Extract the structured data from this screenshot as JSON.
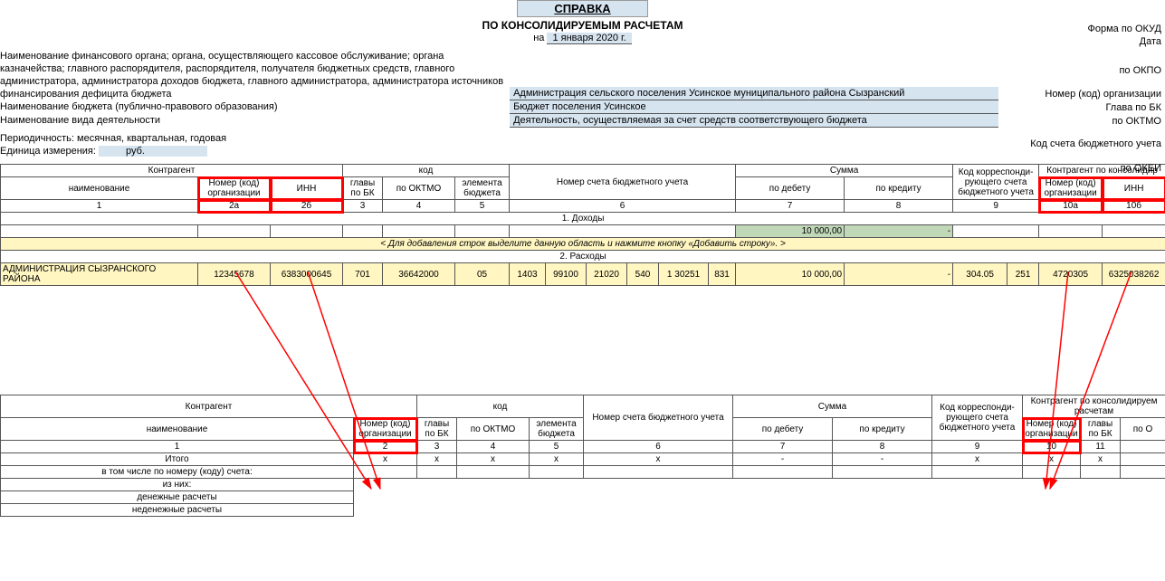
{
  "title": "СПРАВКА",
  "subtitle": "ПО КОНСОЛИДИРУЕМЫМ РАСЧЕТАМ",
  "date_prefix": "на",
  "date": "1 января 2020 г.",
  "right_labels": {
    "okud": "Форма по ОКУД",
    "data": "Дата",
    "okpo": "по ОКПО",
    "orgnum": "Номер (код) организации",
    "glavbk": "Глава по БК",
    "oktmo": "по ОКТМО",
    "acct": "Код счета бюджетного учета",
    "okei": "по ОКЕИ"
  },
  "hdr": {
    "org_label": "Наименование финансового органа; органа, осуществляющего кассовое обслуживание; органа казначейства; главного распорядителя, распорядителя, получателя бюджетных средств, главного администратора, администратора доходов бюджета, главного администратора, администратора источников финансирования дефицита бюджета",
    "org_value": "Администрация сельского поселения Усинское муниципального района Сызранский",
    "budget_label": "Наименование бюджета (публично-правового образования)",
    "budget_value": "Бюджет поселения Усинское",
    "activity_label": "Наименование вида деятельности",
    "activity_value": "Деятельность, осуществляемая за счет средств соответствующего бюджета",
    "period": "Периодичность: месячная, квартальная, годовая",
    "unit_label": "Единица измерения:",
    "unit_value": "руб."
  },
  "cols1": {
    "contr": "Контрагент",
    "name": "наименование",
    "orgnum": "Номер (код) организации",
    "inn": "ИНН",
    "code": "код",
    "glavbk": "главы по БК",
    "oktmo": "по ОКТМО",
    "elem": "элемента бюджета",
    "acct": "Номер счета бюджетного учета",
    "sum": "Сумма",
    "debit": "по дебету",
    "credit": "по кредиту",
    "korr": "Код корреспонди-рующего счета бюджетного учета",
    "contr2": "Контрагент по консолидир"
  },
  "nums1": [
    "1",
    "2а",
    "2б",
    "3",
    "4",
    "5",
    "6",
    "7",
    "8",
    "9",
    "10а",
    "10б"
  ],
  "sec1": "1. Доходы",
  "sec2": "2. Расходы",
  "income_sum": "10 000,00",
  "income_dash": "-",
  "hint": "< Для добавления строк выделите данную область и нажмите кнопку «Добавить строку». >",
  "exp": {
    "name": "АДМИНИСТРАЦИЯ СЫЗРАНСКОГО РАЙОНА",
    "orgnum": "12345678",
    "inn": "6383000645",
    "glavbk": "701",
    "oktmo": "36642000",
    "elem": "05",
    "a1": "1403",
    "a2": "99100",
    "a3": "21020",
    "a4": "540",
    "a5": "1 30251",
    "a6": "831",
    "debit": "10 000,00",
    "credit": "-",
    "k1": "304.05",
    "k2": "251",
    "c_orgnum": "4720305",
    "c_inn": "6325038262"
  },
  "cols2": {
    "contr": "Контрагент",
    "name": "наименование",
    "orgnum": "Номер (код) организации",
    "code": "код",
    "glavbk": "главы по БК",
    "oktmo": "по ОКТМО",
    "elem": "элемента бюджета",
    "acct": "Номер счета бюджетного учета",
    "sum": "Сумма",
    "debit": "по дебету",
    "credit": "по кредиту",
    "korr": "Код корреспонди-рующего счета бюджетного учета",
    "contr2": "Контрагент по консолидируем расчетам",
    "glavbk2": "главы по БК",
    "poO": "по О"
  },
  "nums2": [
    "1",
    "2",
    "3",
    "4",
    "5",
    "6",
    "7",
    "8",
    "9",
    "10",
    "11"
  ],
  "tot": {
    "itogo": "Итого",
    "line2": "в том числе по номеру (коду) счета:",
    "line3": "из них:",
    "line4": "денежные расчеты",
    "line5": "неденежные расчеты",
    "x": "x",
    "dash": "-"
  }
}
